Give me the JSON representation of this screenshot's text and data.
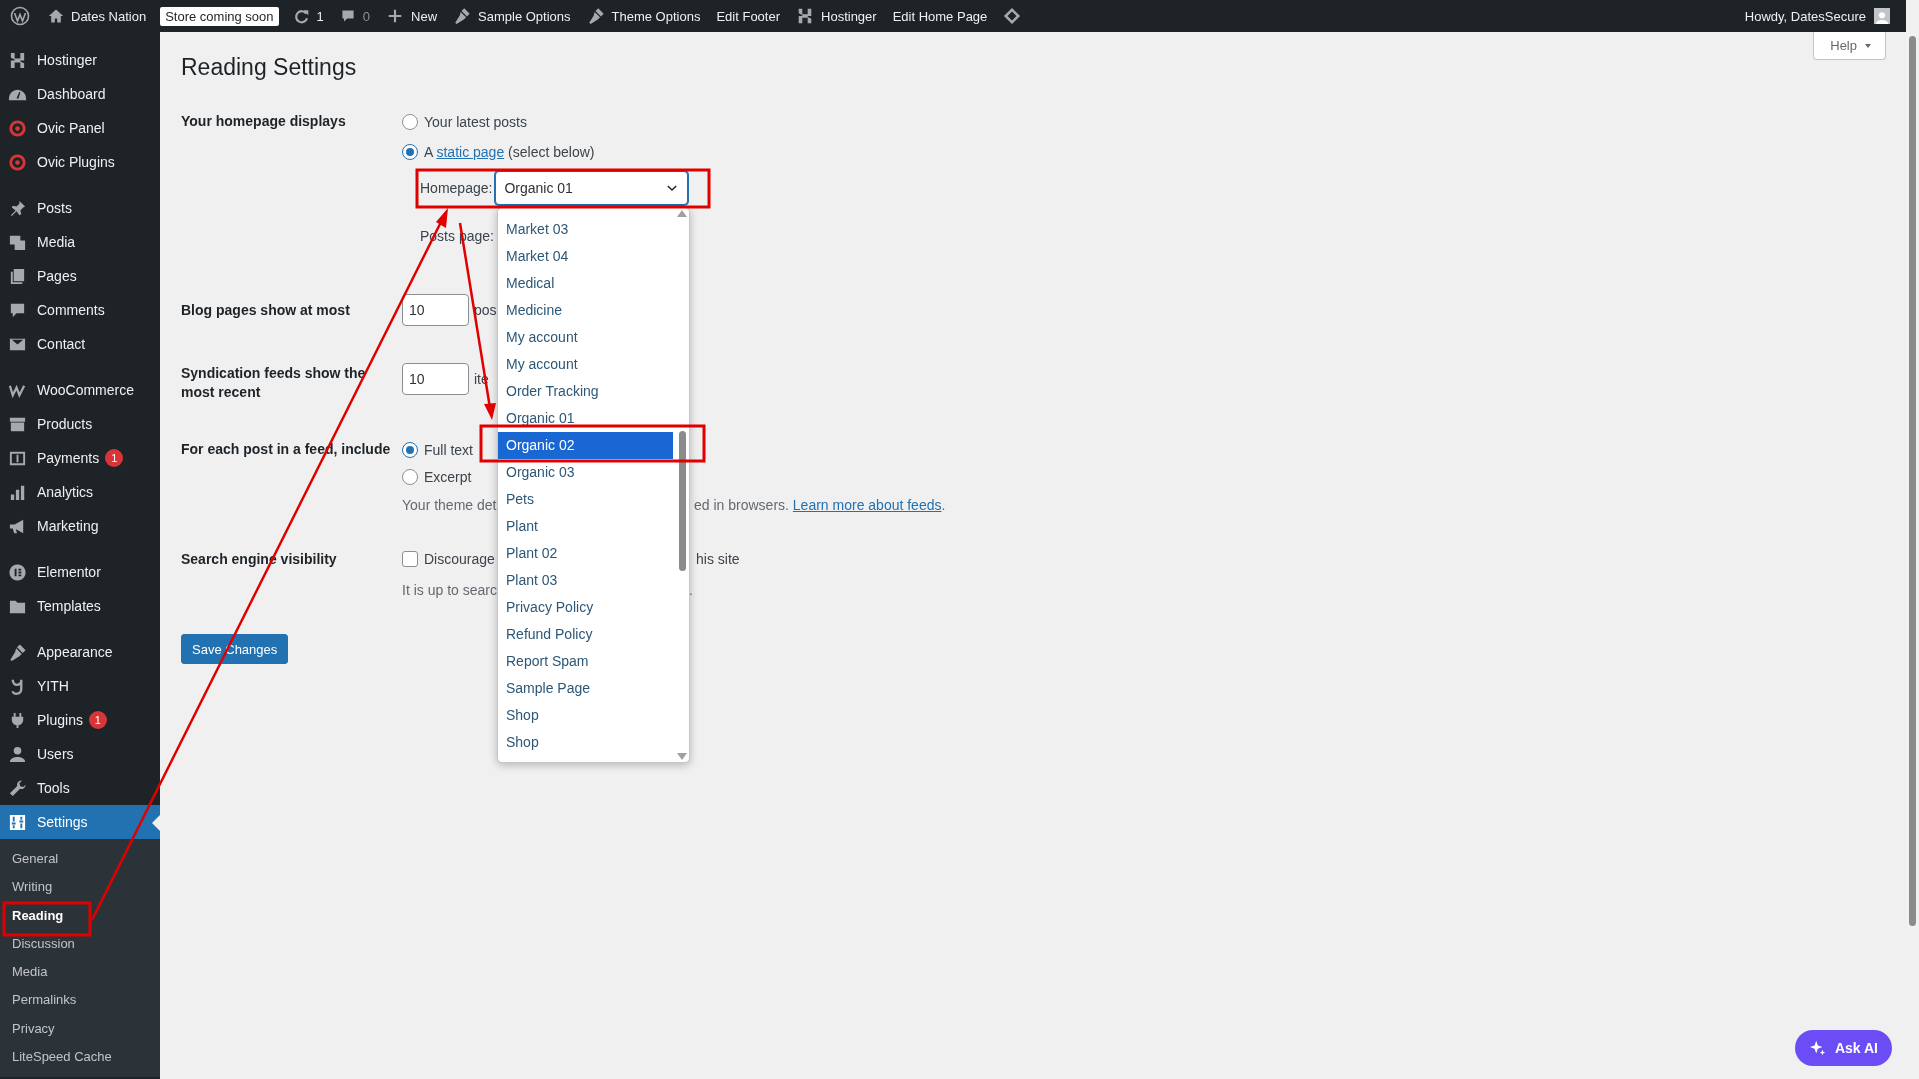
{
  "admin_bar": {
    "site_name": "Dates Nation",
    "badge": "Store coming soon",
    "updates": "1",
    "comments": "0",
    "menu": [
      "New",
      "Sample Options",
      "Theme Options",
      "Edit Footer",
      "Hostinger",
      "Edit Home Page"
    ],
    "greeting": "Howdy, DatesSecure"
  },
  "sidebar": {
    "groups": [
      [
        {
          "label": "Hostinger",
          "selected": false
        },
        {
          "label": "Dashboard",
          "selected": false
        },
        {
          "label": "Ovic Panel",
          "selected": false
        },
        {
          "label": "Ovic Plugins",
          "selected": false
        }
      ],
      [
        {
          "label": "Posts",
          "selected": false
        },
        {
          "label": "Media",
          "selected": false
        },
        {
          "label": "Pages",
          "selected": false
        },
        {
          "label": "Comments",
          "selected": false
        },
        {
          "label": "Contact",
          "selected": false
        }
      ],
      [
        {
          "label": "WooCommerce",
          "selected": false
        },
        {
          "label": "Products",
          "selected": false
        },
        {
          "label": "Payments",
          "badge": "1",
          "selected": false
        },
        {
          "label": "Analytics",
          "selected": false
        },
        {
          "label": "Marketing",
          "selected": false
        }
      ],
      [
        {
          "label": "Elementor",
          "selected": false
        },
        {
          "label": "Templates",
          "selected": false
        }
      ],
      [
        {
          "label": "Appearance",
          "selected": false
        },
        {
          "label": "YITH",
          "selected": false
        },
        {
          "label": "Plugins",
          "badge": "1",
          "selected": false
        },
        {
          "label": "Users",
          "selected": false
        },
        {
          "label": "Tools",
          "selected": false
        },
        {
          "label": "Settings",
          "selected": true
        }
      ]
    ],
    "submenu": [
      {
        "label": "General",
        "selected": false
      },
      {
        "label": "Writing",
        "selected": false
      },
      {
        "label": "Reading",
        "selected": true
      },
      {
        "label": "Discussion",
        "selected": false
      },
      {
        "label": "Media",
        "selected": false
      },
      {
        "label": "Permalinks",
        "selected": false
      },
      {
        "label": "Privacy",
        "selected": false
      },
      {
        "label": "LiteSpeed Cache",
        "selected": false
      }
    ]
  },
  "help_button": "Help",
  "title": "Reading Settings",
  "homepage_displays": {
    "label": "Your homepage displays",
    "options": [
      {
        "text": "Your latest posts",
        "selected": false
      },
      {
        "text": "A",
        "link": "static page",
        "after": "(select below)",
        "selected": true
      }
    ],
    "homepage_label": "Homepage:",
    "homepage_value": "Organic 01",
    "posts_page_label": "Posts page:"
  },
  "dropdown": {
    "options": [
      {
        "label": "Market 03",
        "selected": false
      },
      {
        "label": "Market 04",
        "selected": false
      },
      {
        "label": "Medical",
        "selected": false
      },
      {
        "label": "Medicine",
        "selected": false
      },
      {
        "label": "My account",
        "selected": false
      },
      {
        "label": "My account",
        "selected": false
      },
      {
        "label": "Order Tracking",
        "selected": false
      },
      {
        "label": "Organic 01",
        "selected": false
      },
      {
        "label": "Organic 02",
        "selected": true
      },
      {
        "label": "Organic 03",
        "selected": false
      },
      {
        "label": "Pets",
        "selected": false
      },
      {
        "label": "Plant",
        "selected": false
      },
      {
        "label": "Plant 02",
        "selected": false
      },
      {
        "label": "Plant 03",
        "selected": false
      },
      {
        "label": "Privacy Policy",
        "selected": false
      },
      {
        "label": "Refund Policy",
        "selected": false
      },
      {
        "label": "Report Spam",
        "selected": false
      },
      {
        "label": "Sample Page",
        "selected": false
      },
      {
        "label": "Shop",
        "selected": false
      },
      {
        "label": "Shop",
        "selected": false
      }
    ]
  },
  "blog_pages": {
    "label": "Blog pages show at most",
    "value": "10",
    "unit": "pos"
  },
  "syndication": {
    "label": "Syndication feeds show the most recent",
    "value": "10",
    "unit": "ite"
  },
  "feed_include": {
    "label": "For each post in a feed, include",
    "options": [
      {
        "text": "Full text",
        "selected": true
      },
      {
        "text": "Excerpt",
        "selected": false
      }
    ],
    "description_start": "Your theme det",
    "description_end": "ed in browsers.",
    "link": "Learn more about feeds",
    "end": "."
  },
  "search_engine": {
    "label": "Search engine visibility",
    "checked": false,
    "checkbox_start": "Discourage",
    "checkbox_end": "his site",
    "note_start": "It is up to searc",
    "note_end": "."
  },
  "save_button": "Save Changes",
  "ask_ai": "Ask AI"
}
